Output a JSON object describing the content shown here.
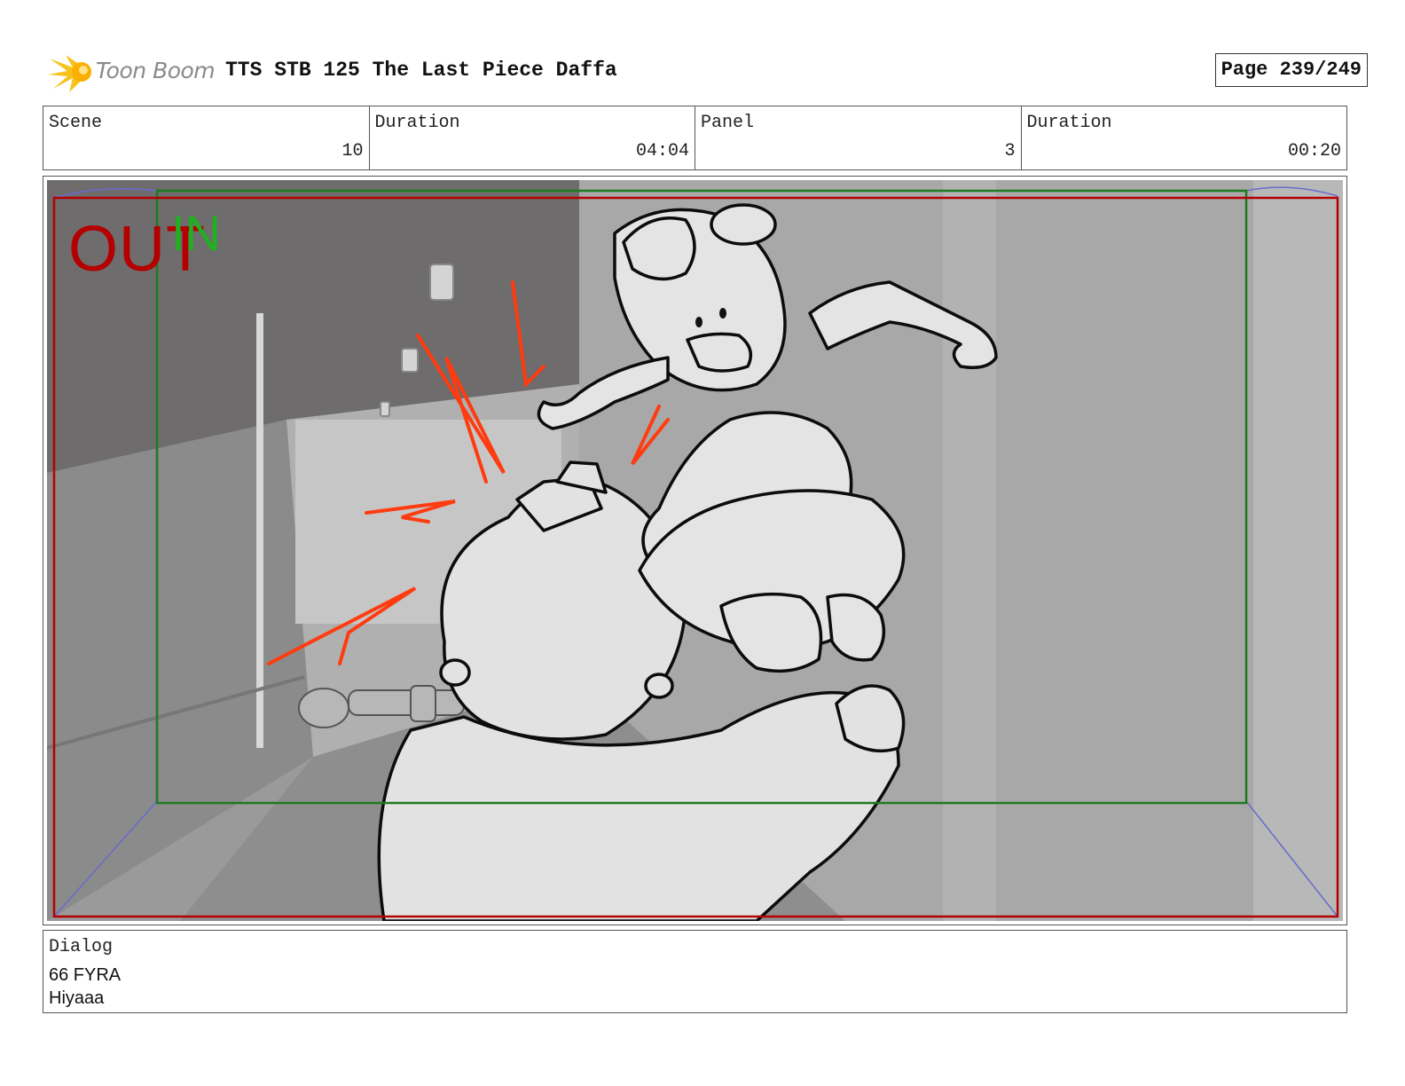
{
  "header": {
    "logo_text": "Toon Boom",
    "title": "TTS STB 125 The Last Piece Daffa",
    "page": "Page 239/249"
  },
  "info": [
    {
      "label": "Scene",
      "value": "10"
    },
    {
      "label": "Duration",
      "value": "04:04"
    },
    {
      "label": "Panel",
      "value": "3"
    },
    {
      "label": "Duration",
      "value": "00:20"
    }
  ],
  "panel": {
    "out_label": "OUT",
    "in_label": "IN",
    "colors": {
      "out_frame": "#b40000",
      "in_frame": "#1f7a1f",
      "effect_lines": "#ff3b10",
      "camera_guides": "#6a6ad0"
    }
  },
  "dialog": {
    "label": "Dialog",
    "lines": [
      "66 FYRA",
      "Hiyaaa"
    ]
  }
}
